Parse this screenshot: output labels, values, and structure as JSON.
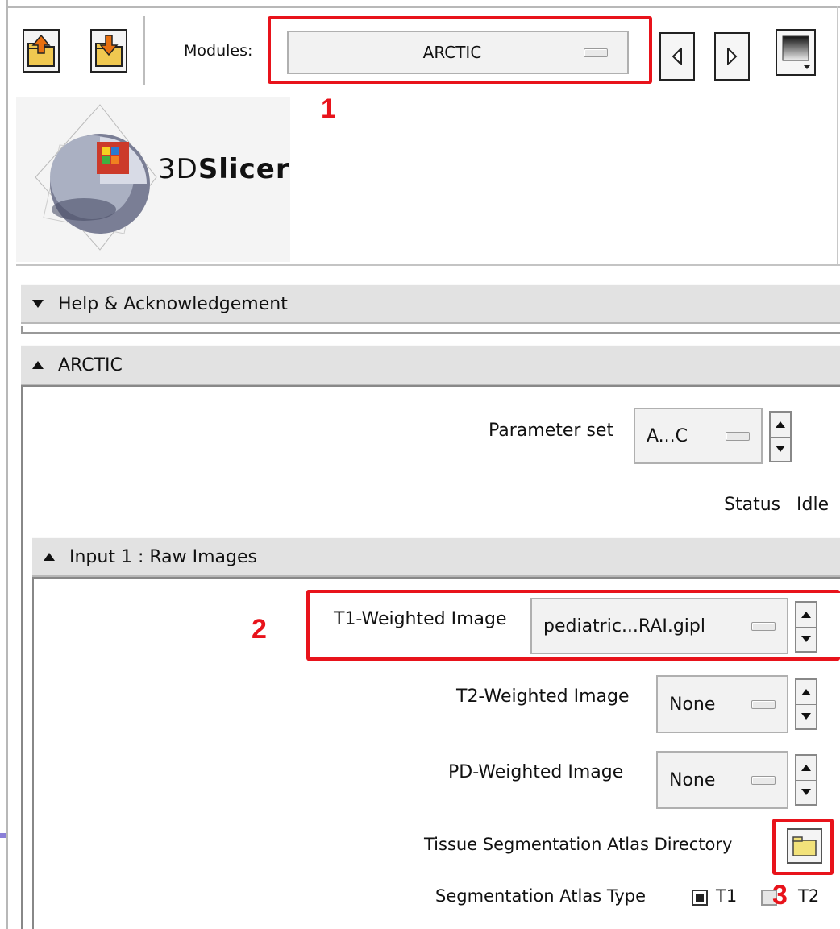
{
  "toolbar": {
    "modules_label": "Modules:",
    "module_selected": "ARCTIC"
  },
  "logo": {
    "prefix": "3D",
    "name": "Slicer"
  },
  "annotations": {
    "n1": "1",
    "n2": "2",
    "n3": "3"
  },
  "sections": {
    "help": "Help & Acknowledgement",
    "arctic": "ARCTIC",
    "input1": "Input 1 : Raw Images"
  },
  "arctic": {
    "parameter_set_label": "Parameter set",
    "parameter_set_value": "A...C",
    "status_label": "Status",
    "status_value": "Idle"
  },
  "inputs": {
    "t1_label": "T1-Weighted Image",
    "t1_value": "pediatric...RAI.gipl",
    "t2_label": "T2-Weighted Image",
    "t2_value": "None",
    "pd_label": "PD-Weighted Image",
    "pd_value": "None",
    "atlas_dir_label": "Tissue Segmentation Atlas Directory",
    "atlas_type_label": "Segmentation Atlas Type",
    "atlas_type_options": [
      "T1",
      "T2"
    ],
    "atlas_type_selected": "T1"
  },
  "colors": {
    "annotation_red": "#e8131b",
    "header_bg": "#e2e2e2"
  }
}
